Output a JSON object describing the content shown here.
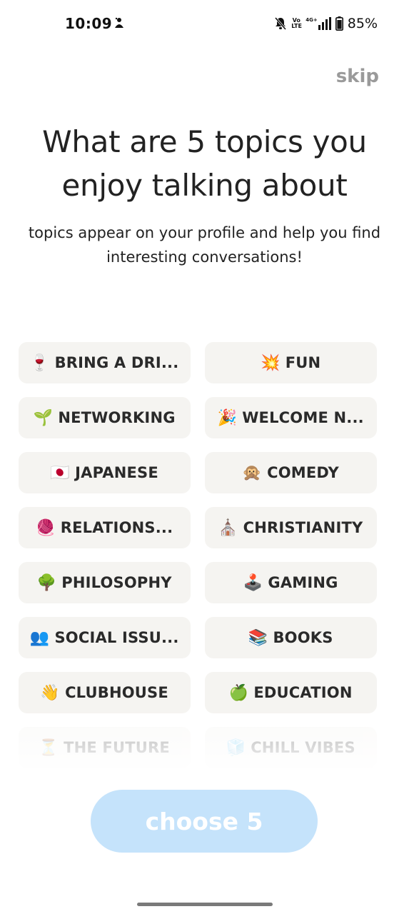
{
  "status_bar": {
    "time": "10:09",
    "battery": "85%",
    "volte_top": "Vo",
    "volte_bottom": "LTE",
    "network": "4G+"
  },
  "skip_label": "skip",
  "heading": "What are 5 topics you enjoy talking about",
  "subheading": "topics appear on your profile and help you find interesting conversations!",
  "topics": [
    {
      "emoji": "🍷",
      "label": "BRING A DRI..."
    },
    {
      "emoji": "💥",
      "label": "FUN"
    },
    {
      "emoji": "🌱",
      "label": "NETWORKING"
    },
    {
      "emoji": "🎉",
      "label": "WELCOME N..."
    },
    {
      "emoji": "🇯🇵",
      "label": "JAPANESE"
    },
    {
      "emoji": "🙊",
      "label": "COMEDY"
    },
    {
      "emoji": "🧶",
      "label": "RELATIONS..."
    },
    {
      "emoji": "⛪",
      "label": "CHRISTIANITY"
    },
    {
      "emoji": "🌳",
      "label": "PHILOSOPHY"
    },
    {
      "emoji": "🕹️",
      "label": "GAMING"
    },
    {
      "emoji": "👥",
      "label": "SOCIAL ISSU..."
    },
    {
      "emoji": "📚",
      "label": "BOOKS"
    },
    {
      "emoji": "👋",
      "label": "CLUBHOUSE"
    },
    {
      "emoji": "🍏",
      "label": "EDUCATION"
    },
    {
      "emoji": "⏳",
      "label": "THE FUTURE"
    },
    {
      "emoji": "🧊",
      "label": "CHILL VIBES"
    }
  ],
  "choose_button_label": "choose 5",
  "colors": {
    "choose_button_bg": "#c5e3fb",
    "topic_bg": "#f5f4f1",
    "skip": "#9a9a9a"
  }
}
